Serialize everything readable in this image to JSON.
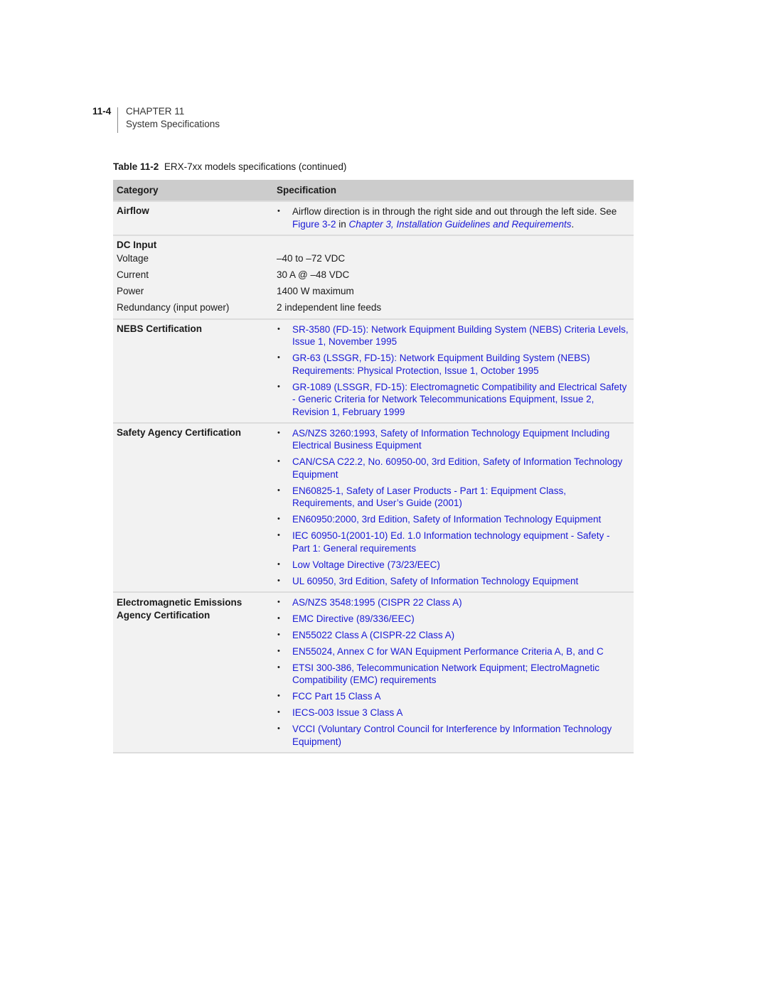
{
  "running_head": {
    "page_number": "11-4",
    "chapter": "CHAPTER 11",
    "section": "System Specifications"
  },
  "caption": {
    "label": "Table 11-2",
    "title": "ERX-7xx models specifications (continued)"
  },
  "table": {
    "headers": [
      "Category",
      "Specification"
    ],
    "airflow": {
      "category": "Airflow",
      "text": "Airflow direction is in through the right side and out through the left side. See ",
      "link1": "Figure 3-2",
      "mid": " in ",
      "link2": "Chapter 3, Installation Guidelines and Requirements",
      "end": "."
    },
    "dc_input": {
      "category": "DC Input",
      "rows": [
        {
          "label": "Voltage",
          "value": "–40 to –72 VDC"
        },
        {
          "label": "Current",
          "value": "30 A @ –48 VDC"
        },
        {
          "label": "Power",
          "value": "1400 W maximum"
        },
        {
          "label": "Redundancy (input power)",
          "value": "2 independent line feeds"
        }
      ]
    },
    "nebs": {
      "category": "NEBS Certification",
      "items": [
        "SR-3580 (FD-15): Network Equipment Building System (NEBS) Criteria Levels, Issue 1, November 1995",
        "GR-63 (LSSGR, FD-15): Network Equipment Building System (NEBS) Requirements: Physical Protection, Issue 1, October 1995",
        "GR-1089 (LSSGR, FD-15): Electromagnetic Compatibility and Electrical Safety - Generic Criteria for Network Telecommunications Equipment, Issue 2, Revision 1, February 1999"
      ]
    },
    "safety": {
      "category": "Safety Agency Certification",
      "items": [
        "AS/NZS 3260:1993, Safety of Information Technology Equipment Including Electrical Business Equipment",
        "CAN/CSA C22.2, No. 60950-00, 3rd Edition, Safety of Information Technology Equipment",
        "EN60825-1, Safety of Laser Products - Part 1: Equipment Class, Requirements, and User’s Guide (2001)",
        "EN60950:2000, 3rd Edition, Safety of Information Technology Equipment",
        "IEC 60950-1(2001-10) Ed. 1.0 Information technology equipment - Safety - Part 1: General requirements",
        "Low Voltage Directive (73/23/EEC)",
        "UL 60950, 3rd Edition, Safety of Information Technology Equipment"
      ]
    },
    "emissions": {
      "category": "Electromagnetic Emissions Agency Certification",
      "items": [
        "AS/NZS 3548:1995 (CISPR 22 Class A)",
        "EMC Directive (89/336/EEC)",
        "EN55022 Class A (CISPR-22 Class A)",
        "EN55024, Annex C for WAN Equipment Performance Criteria A, B, and C",
        "ETSI 300-386, Telecommunication Network Equipment; ElectroMagnetic Compatibility (EMC) requirements",
        "FCC Part 15 Class A",
        "IECS-003 Issue 3 Class A",
        "VCCI (Voluntary Control Council for Interference by Information Technology Equipment)"
      ]
    }
  }
}
